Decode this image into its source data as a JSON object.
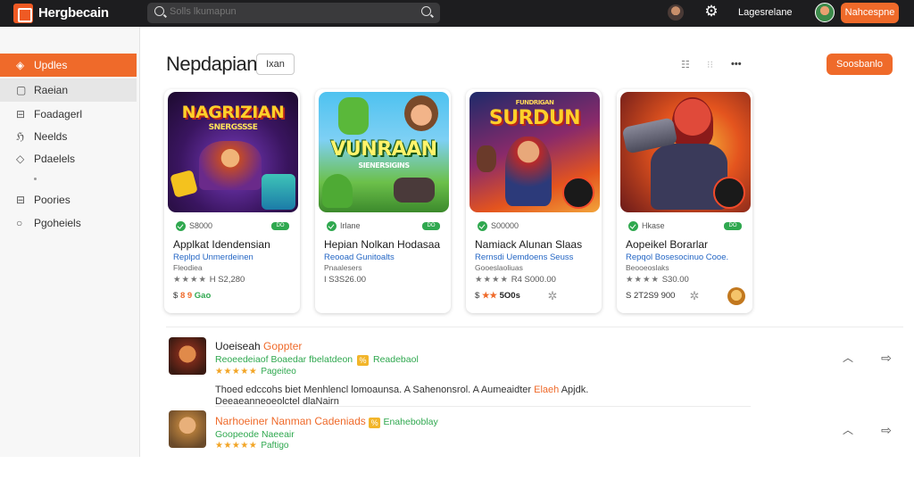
{
  "app": {
    "title": "Hergbecain"
  },
  "search": {
    "placeholder": "Solls lkumapun"
  },
  "topbar": {
    "user_name": "Lagesrelane",
    "button_label": "Nahcespne"
  },
  "sidebar": {
    "items": [
      {
        "label": "Updles",
        "icon": "tag-icon"
      },
      {
        "label": "Raeian",
        "icon": "square-icon"
      },
      {
        "label": "Foadagerl",
        "icon": "box-icon"
      },
      {
        "label": "Neelds",
        "icon": "flag-icon"
      },
      {
        "label": "Pdaelels",
        "icon": "diamond-icon"
      },
      {
        "label": "Poories",
        "icon": "box-icon"
      },
      {
        "label": "Pgoheiels",
        "icon": "chat-icon"
      }
    ]
  },
  "main": {
    "title": "Nepdapian",
    "chip": "Ixan",
    "action_button": "Soosbanlo"
  },
  "cards": [
    {
      "art_title_1": "NAGRIZIAN",
      "art_title_2": "SNERGSSSE",
      "meta": "S8000",
      "badge": "DO",
      "name": "Applkat Idendensian",
      "dev": "Replpd Unmerdeinen",
      "cat": "Fleodiea",
      "stars": "★★★★",
      "rating_text": "H  S2,280",
      "price_a": "$ ",
      "price_hot": "8 9",
      "price_gr": " Gao"
    },
    {
      "art_title_1": "VUNRAAN",
      "art_title_2": "SIENERSIGINS",
      "meta": "Irlane",
      "badge": "DO",
      "name": "Hepian Nolkan Hodasaa",
      "dev": "Reooad Gunitoalts",
      "cat": "Pnaalesers",
      "stars": "",
      "rating_text": "I  S3S26.00",
      "price_a": "",
      "price_hot": "",
      "price_gr": ""
    },
    {
      "art_title_1": "SURDUN",
      "art_title_2": "FUNDRIGAN",
      "meta": "S00000",
      "badge": "DO",
      "name": "Namiack Alunan Slaas",
      "dev": "Rernsdi Uemdoens Seuss",
      "cat": "Gooeslaoliuas",
      "stars": "★★★★",
      "rating_text": "R4  S000.00",
      "price_a": "$ ",
      "price_hot": "★★",
      "price_gr": " 5O0s"
    },
    {
      "art_title_1": "",
      "art_title_2": "",
      "meta": "Hkase",
      "badge": "DO",
      "name": "Aopeikel Borarlar",
      "dev": "Repqol Bosesocinuo Cooe.",
      "cat": "Beooeoslaks",
      "stars": "★★★★",
      "rating_text": "S30.00",
      "price_a": "S 2T2S9",
      "price_hot": "",
      "price_gr": " 900"
    }
  ],
  "list": [
    {
      "title_a": "Uoeiseah ",
      "title_b": "Goppter",
      "dev_a": "Reoeedeiaof Boaedar fbelatdeon",
      "dev_tag": "%",
      "dev_b": "Readebaol",
      "stars": "★★★★★",
      "stars_label": "Pageiteo",
      "desc_1a": "Thoed edccohs biet Menhlencl lomoaunsa. A Sahenonsrol. A Aumeaidter ",
      "desc_1b": "Elaeh",
      "desc_1c": " Apjdk.",
      "desc_2": "Deeaeanneoeolctel dlaNairn"
    },
    {
      "title_a": "Narhoeiner Nanman Cadeniads ",
      "title_b": "",
      "dev_a": "",
      "dev_tag": "%",
      "dev_b": "Enaheboblay",
      "dev_line2": "Goopeode Naeeair",
      "stars": "★★★★★",
      "stars_label": "Paftigo",
      "desc_1a": "",
      "desc_1b": "",
      "desc_1c": "",
      "desc_2": ""
    }
  ],
  "colors": {
    "accent": "#ef6a2a",
    "topbar": "#1d1d1f",
    "green": "#2fa84f",
    "link": "#2466c4"
  }
}
